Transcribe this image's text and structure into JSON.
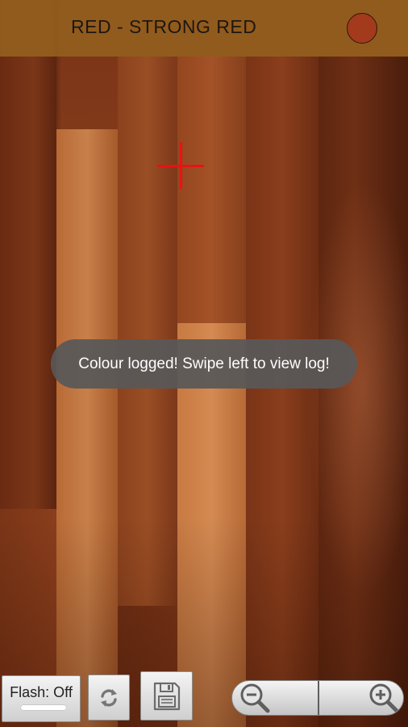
{
  "header": {
    "color_name": "RED - STRONG RED",
    "swatch_color": "#a33a1c"
  },
  "crosshair": {
    "color": "#e81212"
  },
  "toast": {
    "message": "Colour logged! Swipe left to view log!"
  },
  "controls": {
    "flash_label": "Flash: Off",
    "switch_camera_icon": "refresh-icon",
    "save_icon": "floppy-disk-icon",
    "zoom_out_icon": "zoom-out-icon",
    "zoom_in_icon": "zoom-in-icon"
  }
}
